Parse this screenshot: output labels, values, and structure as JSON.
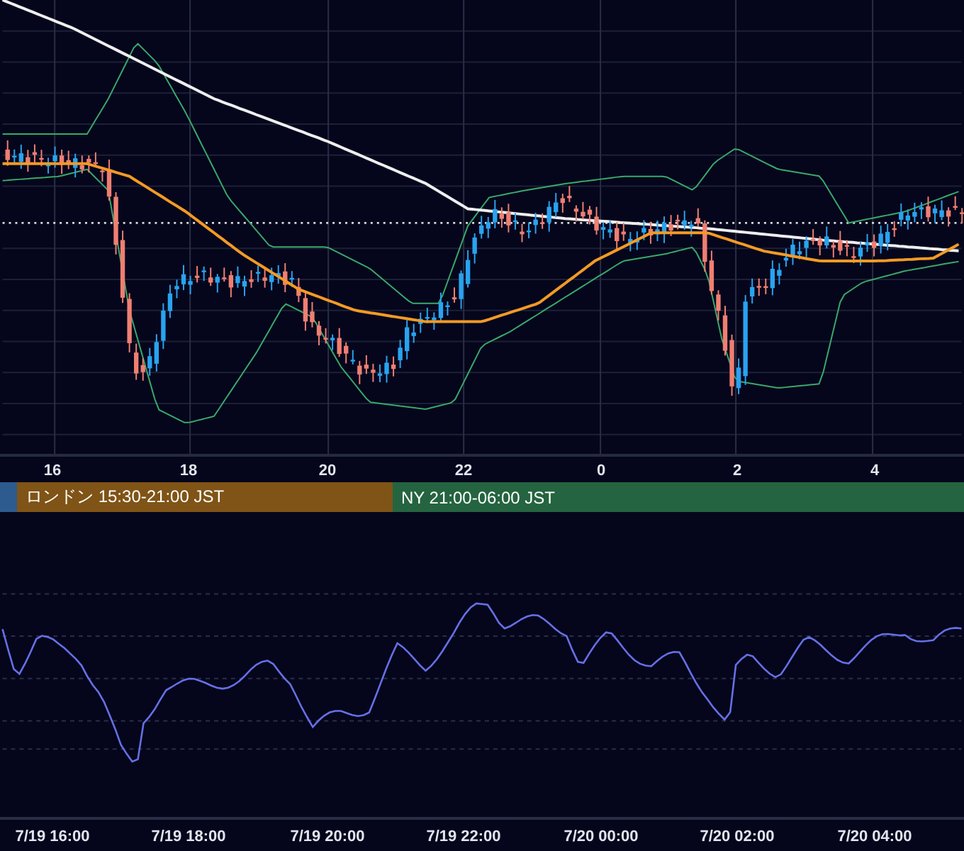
{
  "time_axis": {
    "ticks": [
      "16",
      "18",
      "20",
      "22",
      "0",
      "2",
      "4"
    ]
  },
  "sessions": [
    {
      "color": "#2d5b8f"
    },
    {
      "label": "ロンドン 15:30-21:00 JST",
      "color": "#7f5416"
    },
    {
      "label": "NY 21:00-06:00 JST",
      "color": "#256440"
    }
  ],
  "date_axis": {
    "ticks": [
      "7/19 16:00",
      "7/19 18:00",
      "7/19 20:00",
      "7/19 22:00",
      "7/20 00:00",
      "7/20 02:00",
      "7/20 04:00"
    ]
  }
}
